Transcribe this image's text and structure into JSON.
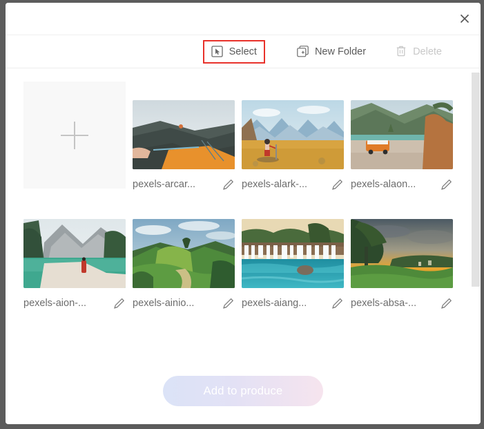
{
  "dialog": {
    "close_label": "×",
    "close_icon": "close-icon"
  },
  "toolbar": {
    "select": {
      "label": "Select",
      "icon": "cursor-select-icon",
      "highlighted": true,
      "disabled": false
    },
    "new_folder": {
      "label": "New Folder",
      "icon": "folder-plus-icon",
      "highlighted": false,
      "disabled": false
    },
    "delete": {
      "label": "Delete",
      "icon": "trash-icon",
      "highlighted": false,
      "disabled": true
    },
    "highlight_color": "#e8312a"
  },
  "uploader": {
    "icon": "plus-icon",
    "tooltip": ""
  },
  "gallery": {
    "items": [
      {
        "name": "pexels-arcar...",
        "edit_icon": "pencil-icon",
        "scene": "climber-tent-cliff"
      },
      {
        "name": "pexels-alark-...",
        "edit_icon": "pencil-icon",
        "scene": "hiker-mountain-plateau"
      },
      {
        "name": "pexels-alaon...",
        "edit_icon": "pencil-icon",
        "scene": "orange-van-lake"
      },
      {
        "name": "pexels-aion-...",
        "edit_icon": "pencil-icon",
        "scene": "lake-braies-red-jacket"
      },
      {
        "name": "pexels-ainio...",
        "edit_icon": "pencil-icon",
        "scene": "green-hills-tree"
      },
      {
        "name": "pexels-aiang...",
        "edit_icon": "pencil-icon",
        "scene": "waterfalls-turquoise-pool"
      },
      {
        "name": "pexels-absa-...",
        "edit_icon": "pencil-icon",
        "scene": "sunset-meadow-tree"
      }
    ]
  },
  "footer": {
    "cta_label": "Add to produce",
    "cta_disabled": true
  },
  "scrollbar": {
    "orientation": "vertical",
    "thumb_color": "#e2e2e2"
  }
}
